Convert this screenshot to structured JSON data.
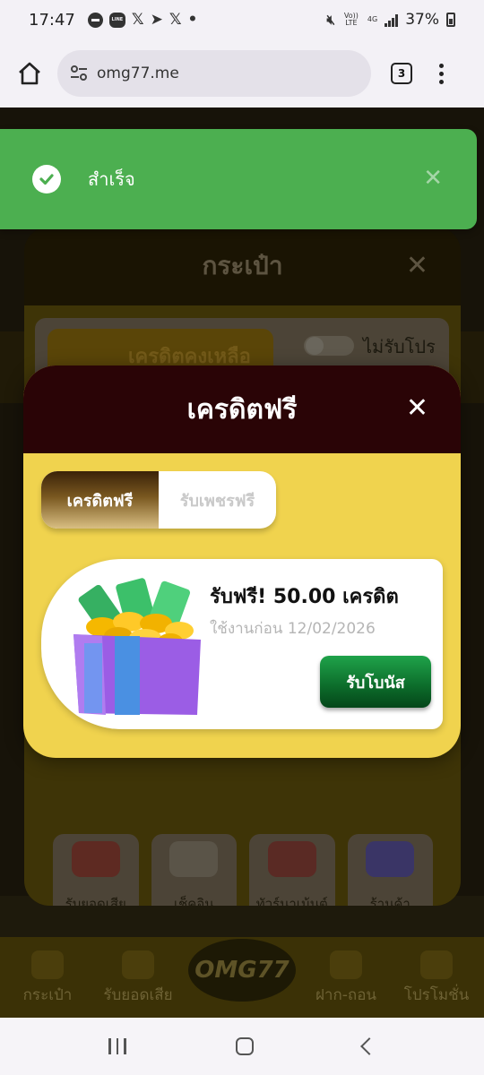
{
  "status_bar": {
    "time": "17:47",
    "volte": "Vo)) LTE",
    "network": "4G",
    "battery": "37%"
  },
  "browser": {
    "url": "omg77.me",
    "tab_count": "3"
  },
  "toast": {
    "message": "สำเร็จ",
    "color": "#4caf50"
  },
  "wallet": {
    "title": "กระเป๋า",
    "credit_label": "เครดิตคงเหลือ",
    "no_promo_label": "ไม่รับโปร",
    "tiles": [
      {
        "label": "รับยอดเสีย"
      },
      {
        "label": "เช็คอิน"
      },
      {
        "label": "ทัวร์นาเม้นต์"
      },
      {
        "label": "ร้านค้า"
      }
    ]
  },
  "modal": {
    "title": "เครดิตฟรี",
    "tabs": [
      {
        "label": "เครดิตฟรี",
        "active": true
      },
      {
        "label": "รับเพชรฟรี",
        "active": false
      }
    ],
    "offer": {
      "title": "รับฟรี! 50.00 เครดิต",
      "expiry": "ใช้งานก่อน 12/02/2026",
      "button": "รับโบนัส",
      "icon": "gift-box-icon"
    },
    "header_color": "#2a0406",
    "body_color": "#f0d34e"
  },
  "bottom_nav": {
    "items": [
      {
        "label": "กระเป๋า"
      },
      {
        "label": "รับยอดเสีย"
      },
      {
        "label": "OMG77"
      },
      {
        "label": "ฝาก-ถอน"
      },
      {
        "label": "โปรโมชั่น"
      }
    ]
  }
}
